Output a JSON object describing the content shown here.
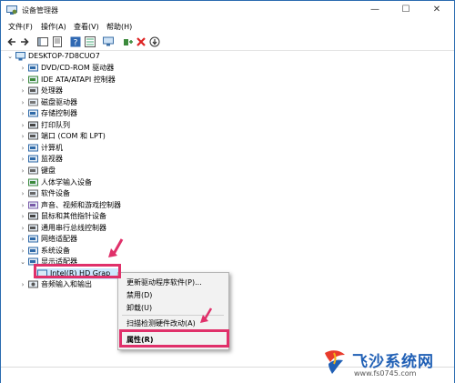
{
  "window": {
    "title": "设备管理器",
    "min": "—",
    "max": "☐",
    "close": "✕"
  },
  "menu": [
    "文件(F)",
    "操作(A)",
    "查看(V)",
    "帮助(H)"
  ],
  "tree": {
    "root": "DESKTOP-7D8CUO7",
    "categories": [
      {
        "label": "DVD/CD-ROM 驱动器",
        "icon": "dvd-drive-icon"
      },
      {
        "label": "IDE ATA/ATAPI 控制器",
        "icon": "ide-controller-icon"
      },
      {
        "label": "处理器",
        "icon": "processor-icon"
      },
      {
        "label": "磁盘驱动器",
        "icon": "disk-drive-icon"
      },
      {
        "label": "存储控制器",
        "icon": "storage-controller-icon"
      },
      {
        "label": "打印队列",
        "icon": "printer-icon"
      },
      {
        "label": "端口 (COM 和 LPT)",
        "icon": "port-icon"
      },
      {
        "label": "计算机",
        "icon": "computer-icon"
      },
      {
        "label": "监视器",
        "icon": "monitor-icon"
      },
      {
        "label": "键盘",
        "icon": "keyboard-icon"
      },
      {
        "label": "人体学输入设备",
        "icon": "hid-icon"
      },
      {
        "label": "软件设备",
        "icon": "software-device-icon"
      },
      {
        "label": "声音、视频和游戏控制器",
        "icon": "sound-icon"
      },
      {
        "label": "鼠标和其他指针设备",
        "icon": "mouse-icon"
      },
      {
        "label": "通用串行总线控制器",
        "icon": "usb-icon"
      },
      {
        "label": "网络适配器",
        "icon": "network-adapter-icon"
      },
      {
        "label": "系统设备",
        "icon": "system-device-icon"
      },
      {
        "label": "显示适配器",
        "icon": "display-adapter-icon"
      }
    ],
    "selected_device": "Intel(R) HD Grap",
    "after_category": "音频输入和输出"
  },
  "context_menu": {
    "items": [
      "更新驱动程序软件(P)...",
      "禁用(D)",
      "卸载(U)",
      "扫描检测硬件改动(A)",
      "属性(R)"
    ]
  },
  "watermark": {
    "brand": "飞沙系统网",
    "url": "www.fs0745.com"
  },
  "colors": {
    "highlight": "#e0306a",
    "selection": "#cce8ff",
    "accent": "#2b6cb0"
  }
}
